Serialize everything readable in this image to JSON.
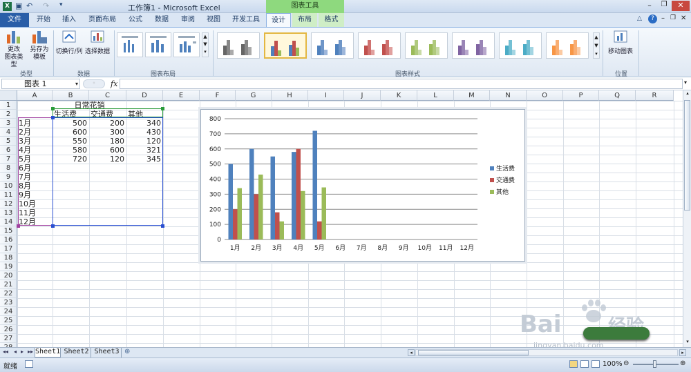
{
  "app": {
    "title": "工作簿1 - Microsoft Excel",
    "context_tool": "图表工具"
  },
  "tabs": [
    "文件",
    "开始",
    "插入",
    "页面布局",
    "公式",
    "数据",
    "审阅",
    "视图",
    "开发工具",
    "设计",
    "布局",
    "格式"
  ],
  "active_tab": "设计",
  "ribbon": {
    "type_group": {
      "label": "类型",
      "change_chart_type": "更改\n图表类型",
      "save_template": "另存为\n模板"
    },
    "data_group": {
      "label": "数据",
      "switch_row_col": "切换行/列",
      "select_data": "选择数据"
    },
    "layout_group": {
      "label": "图表布局"
    },
    "style_group": {
      "label": "图表样式"
    },
    "location_group": {
      "label": "位置",
      "move_chart": "移动图表"
    },
    "style_colors": [
      [
        "#666666",
        "#888888",
        "#aaaaaa"
      ],
      [
        "#4f81bd",
        "#c0504d",
        "#9bbb59"
      ],
      [
        "#4f81bd",
        "#6f96c8",
        "#9db6da"
      ],
      [
        "#c0504d",
        "#d07270",
        "#e0a09e"
      ],
      [
        "#9bbb59",
        "#b0ca7e",
        "#c8daa6"
      ],
      [
        "#8064a2",
        "#9a85b6",
        "#b8a8cc"
      ],
      [
        "#4bacc6",
        "#74c0d4",
        "#a3d5e2"
      ],
      [
        "#f79646",
        "#f9ae73",
        "#fbcaa3"
      ]
    ]
  },
  "formula_bar": {
    "name_box": "图表 1",
    "fx": "fx",
    "value": ""
  },
  "columns": [
    "A",
    "B",
    "C",
    "D",
    "E",
    "F",
    "G",
    "H",
    "I",
    "J",
    "K",
    "L",
    "M",
    "N",
    "O",
    "P",
    "Q",
    "R"
  ],
  "rows": [
    "1",
    "2",
    "3",
    "4",
    "5",
    "6",
    "7",
    "8",
    "9",
    "10",
    "11",
    "12",
    "13",
    "14",
    "15",
    "16",
    "17",
    "18",
    "19",
    "20",
    "21",
    "22",
    "23",
    "24",
    "25",
    "26",
    "27",
    "28"
  ],
  "sheet": {
    "title": "日常花销",
    "headers": [
      "生活费",
      "交通费",
      "其他"
    ],
    "months": [
      "1月",
      "2月",
      "3月",
      "4月",
      "5月",
      "6月",
      "7月",
      "8月",
      "9月",
      "10月",
      "11月",
      "12月"
    ],
    "values": [
      [
        "500",
        "200",
        "340"
      ],
      [
        "600",
        "300",
        "430"
      ],
      [
        "550",
        "180",
        "120"
      ],
      [
        "580",
        "600",
        "321"
      ],
      [
        "720",
        "120",
        "345"
      ]
    ]
  },
  "chart_data": {
    "type": "bar",
    "categories": [
      "1月",
      "2月",
      "3月",
      "4月",
      "5月",
      "6月",
      "7月",
      "8月",
      "9月",
      "10月",
      "11月",
      "12月"
    ],
    "series": [
      {
        "name": "生活费",
        "color": "#4f81bd",
        "values": [
          500,
          600,
          550,
          580,
          720,
          null,
          null,
          null,
          null,
          null,
          null,
          null
        ]
      },
      {
        "name": "交通费",
        "color": "#c0504d",
        "values": [
          200,
          300,
          180,
          600,
          120,
          null,
          null,
          null,
          null,
          null,
          null,
          null
        ]
      },
      {
        "name": "其他",
        "color": "#9bbb59",
        "values": [
          340,
          430,
          120,
          321,
          345,
          null,
          null,
          null,
          null,
          null,
          null,
          null
        ]
      }
    ],
    "ylim": [
      0,
      800
    ],
    "yticks": [
      "0",
      "100",
      "200",
      "300",
      "400",
      "500",
      "600",
      "700",
      "800"
    ],
    "grid": true,
    "legend": "right"
  },
  "sheet_tabs": [
    "Sheet1",
    "Sheet2",
    "Sheet3"
  ],
  "status": {
    "ready": "就绪",
    "zoom": "100%"
  },
  "watermark": {
    "brand": "Bai",
    "brand2": "经验",
    "url": "jingyan.baidu.com"
  }
}
